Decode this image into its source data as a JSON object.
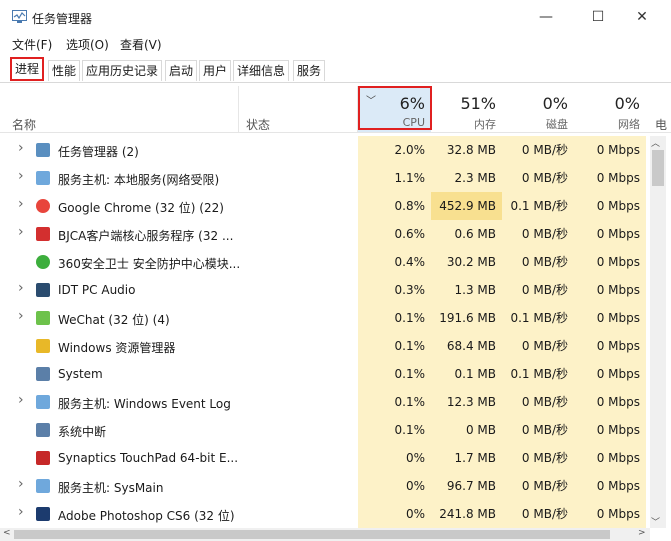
{
  "window": {
    "title": "任务管理器"
  },
  "menu": [
    "文件(F)",
    "选项(O)",
    "查看(V)"
  ],
  "tabs": [
    "进程",
    "性能",
    "应用历史记录",
    "启动",
    "用户",
    "详细信息",
    "服务"
  ],
  "headers": {
    "name": "名称",
    "status": "状态",
    "cpu_pct": "6%",
    "cpu_label": "CPU",
    "mem_pct": "51%",
    "mem_label": "内存",
    "disk_pct": "0%",
    "disk_label": "磁盘",
    "net_pct": "0%",
    "net_label": "网络",
    "elec_label": "电"
  },
  "processes": [
    {
      "name": "任务管理器 (2)",
      "cpu": "2.0%",
      "mem": "32.8 MB",
      "disk": "0 MB/秒",
      "net": "0 Mbps",
      "expand": true,
      "icon": "task-manager-icon",
      "color": "#5a8fc0"
    },
    {
      "name": "服务主机: 本地服务(网络受限)",
      "cpu": "1.1%",
      "mem": "2.3 MB",
      "disk": "0 MB/秒",
      "net": "0 Mbps",
      "expand": true,
      "icon": "service-host-icon",
      "color": "#6fa8dc"
    },
    {
      "name": "Google Chrome (32 位) (22)",
      "cpu": "0.8%",
      "mem": "452.9 MB",
      "disk": "0.1 MB/秒",
      "net": "0 Mbps",
      "expand": true,
      "icon": "chrome-icon",
      "color": "#e8453c"
    },
    {
      "name": "BJCA客户端核心服务程序 (32 ...",
      "cpu": "0.6%",
      "mem": "0.6 MB",
      "disk": "0 MB/秒",
      "net": "0 Mbps",
      "expand": true,
      "icon": "bjca-icon",
      "color": "#d32f2f"
    },
    {
      "name": "360安全卫士 安全防护中心模块...",
      "cpu": "0.4%",
      "mem": "30.2 MB",
      "disk": "0 MB/秒",
      "net": "0 Mbps",
      "expand": false,
      "icon": "360-safe-icon",
      "color": "#3dae3d"
    },
    {
      "name": "IDT PC Audio",
      "cpu": "0.3%",
      "mem": "1.3 MB",
      "disk": "0 MB/秒",
      "net": "0 Mbps",
      "expand": true,
      "icon": "audio-icon",
      "color": "#2b4c6f"
    },
    {
      "name": "WeChat (32 位) (4)",
      "cpu": "0.1%",
      "mem": "191.6 MB",
      "disk": "0.1 MB/秒",
      "net": "0 Mbps",
      "expand": true,
      "icon": "wechat-icon",
      "color": "#6dc24b"
    },
    {
      "name": "Windows 资源管理器",
      "cpu": "0.1%",
      "mem": "68.4 MB",
      "disk": "0 MB/秒",
      "net": "0 Mbps",
      "expand": false,
      "icon": "folder-icon",
      "color": "#e8b828"
    },
    {
      "name": "System",
      "cpu": "0.1%",
      "mem": "0.1 MB",
      "disk": "0.1 MB/秒",
      "net": "0 Mbps",
      "expand": false,
      "icon": "system-icon",
      "color": "#5b7fa8"
    },
    {
      "name": "服务主机: Windows Event Log",
      "cpu": "0.1%",
      "mem": "12.3 MB",
      "disk": "0 MB/秒",
      "net": "0 Mbps",
      "expand": true,
      "icon": "service-host-icon",
      "color": "#6fa8dc"
    },
    {
      "name": "系统中断",
      "cpu": "0.1%",
      "mem": "0 MB",
      "disk": "0 MB/秒",
      "net": "0 Mbps",
      "expand": false,
      "icon": "interrupt-icon",
      "color": "#5b7fa8"
    },
    {
      "name": "Synaptics TouchPad 64-bit E...",
      "cpu": "0%",
      "mem": "1.7 MB",
      "disk": "0 MB/秒",
      "net": "0 Mbps",
      "expand": false,
      "icon": "synaptics-icon",
      "color": "#c62828"
    },
    {
      "name": "服务主机: SysMain",
      "cpu": "0%",
      "mem": "96.7 MB",
      "disk": "0 MB/秒",
      "net": "0 Mbps",
      "expand": true,
      "icon": "service-host-icon",
      "color": "#6fa8dc"
    },
    {
      "name": "Adobe Photoshop CS6 (32 位)",
      "cpu": "0%",
      "mem": "241.8 MB",
      "disk": "0 MB/秒",
      "net": "0 Mbps",
      "expand": true,
      "icon": "photoshop-icon",
      "color": "#1c3b6e"
    }
  ]
}
